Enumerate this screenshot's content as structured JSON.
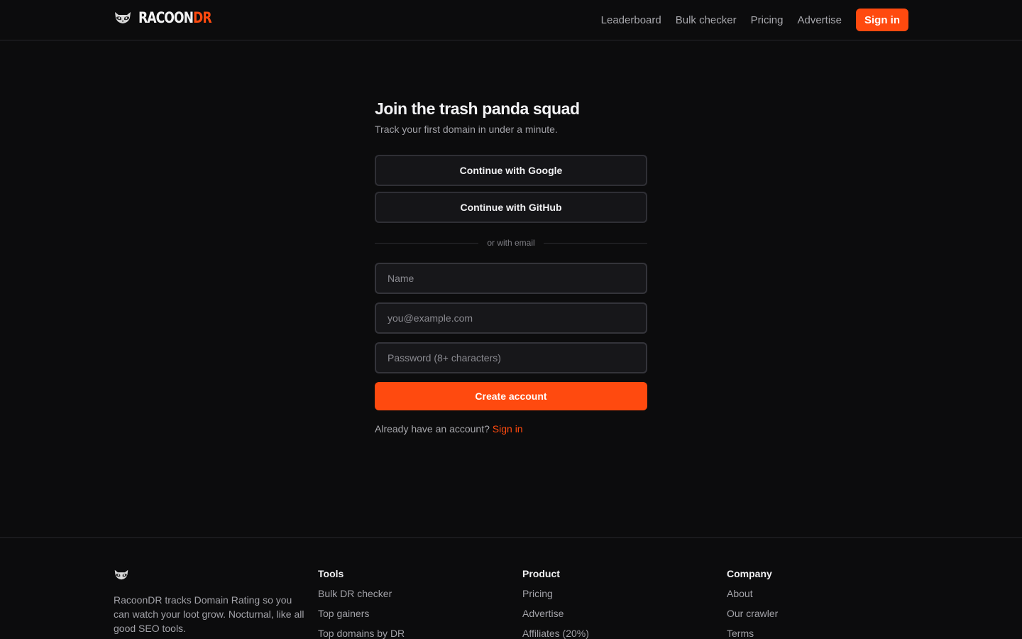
{
  "header": {
    "brand_main": "RACOON",
    "brand_accent": "DR",
    "nav": [
      "Leaderboard",
      "Bulk checker",
      "Pricing",
      "Advertise"
    ],
    "signin_label": "Sign in"
  },
  "form": {
    "title": "Join the trash panda squad",
    "subtitle": "Track your first domain in under a minute.",
    "google_label": "Continue with Google",
    "github_label": "Continue with GitHub",
    "divider_text": "or with email",
    "name_placeholder": "Name",
    "email_placeholder": "you@example.com",
    "password_placeholder": "Password (8+ characters)",
    "create_label": "Create account",
    "already_text": "Already have an account?",
    "already_link": "Sign in"
  },
  "footer": {
    "about": "RacoonDR tracks Domain Rating so you can watch your loot grow. Nocturnal, like all good SEO tools.",
    "columns": [
      {
        "title": "Tools",
        "links": [
          "Bulk DR checker",
          "Top gainers",
          "Top domains by DR"
        ]
      },
      {
        "title": "Product",
        "links": [
          "Pricing",
          "Advertise",
          "Affiliates (20%)"
        ]
      },
      {
        "title": "Company",
        "links": [
          "About",
          "Our crawler",
          "Terms"
        ]
      }
    ]
  },
  "colors": {
    "accent": "#ff4a0f",
    "background": "#0c0c0d"
  },
  "icons": [
    "raccoon-logo-icon"
  ]
}
